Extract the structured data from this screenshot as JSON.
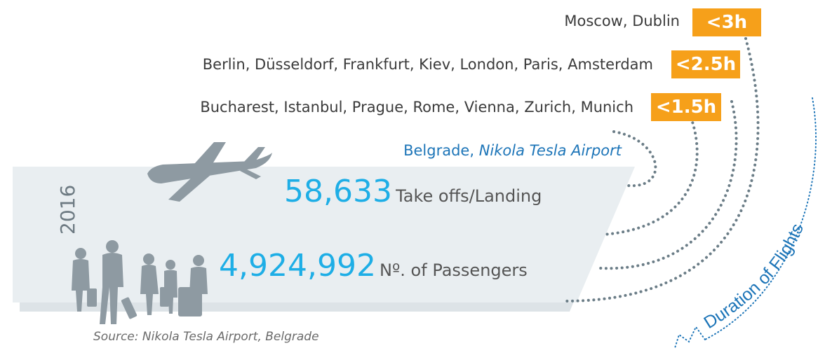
{
  "destinations": [
    {
      "cities": "Moscow, Dublin",
      "duration": "<3h"
    },
    {
      "cities": "Berlin, Düsseldorf, Frankfurt, Kiev, London, Paris, Amsterdam",
      "duration": "<2.5h"
    },
    {
      "cities": "Bucharest, Istanbul, Prague, Rome, Vienna, Zurich, Munich",
      "duration": "<1.5h"
    }
  ],
  "origin": {
    "city": "Belgrade,",
    "airport": "Nikola Tesla Airport"
  },
  "year": "2016",
  "stats": [
    {
      "value": "58,633",
      "label": "Take offs/Landing"
    },
    {
      "value": "4,924,992",
      "label": "Nº. of Passengers"
    }
  ],
  "axis_label": "Duration of Flights",
  "source": "Source: Nikola Tesla Airport, Belgrade",
  "colors": {
    "accent_orange": "#f6a01a",
    "blue": "#1eaee6",
    "dark_blue": "#1d75b8",
    "panel": "#e9eef1",
    "dots": "#6b7d87"
  },
  "icons": [
    "airplane-icon",
    "passengers-illustration"
  ]
}
